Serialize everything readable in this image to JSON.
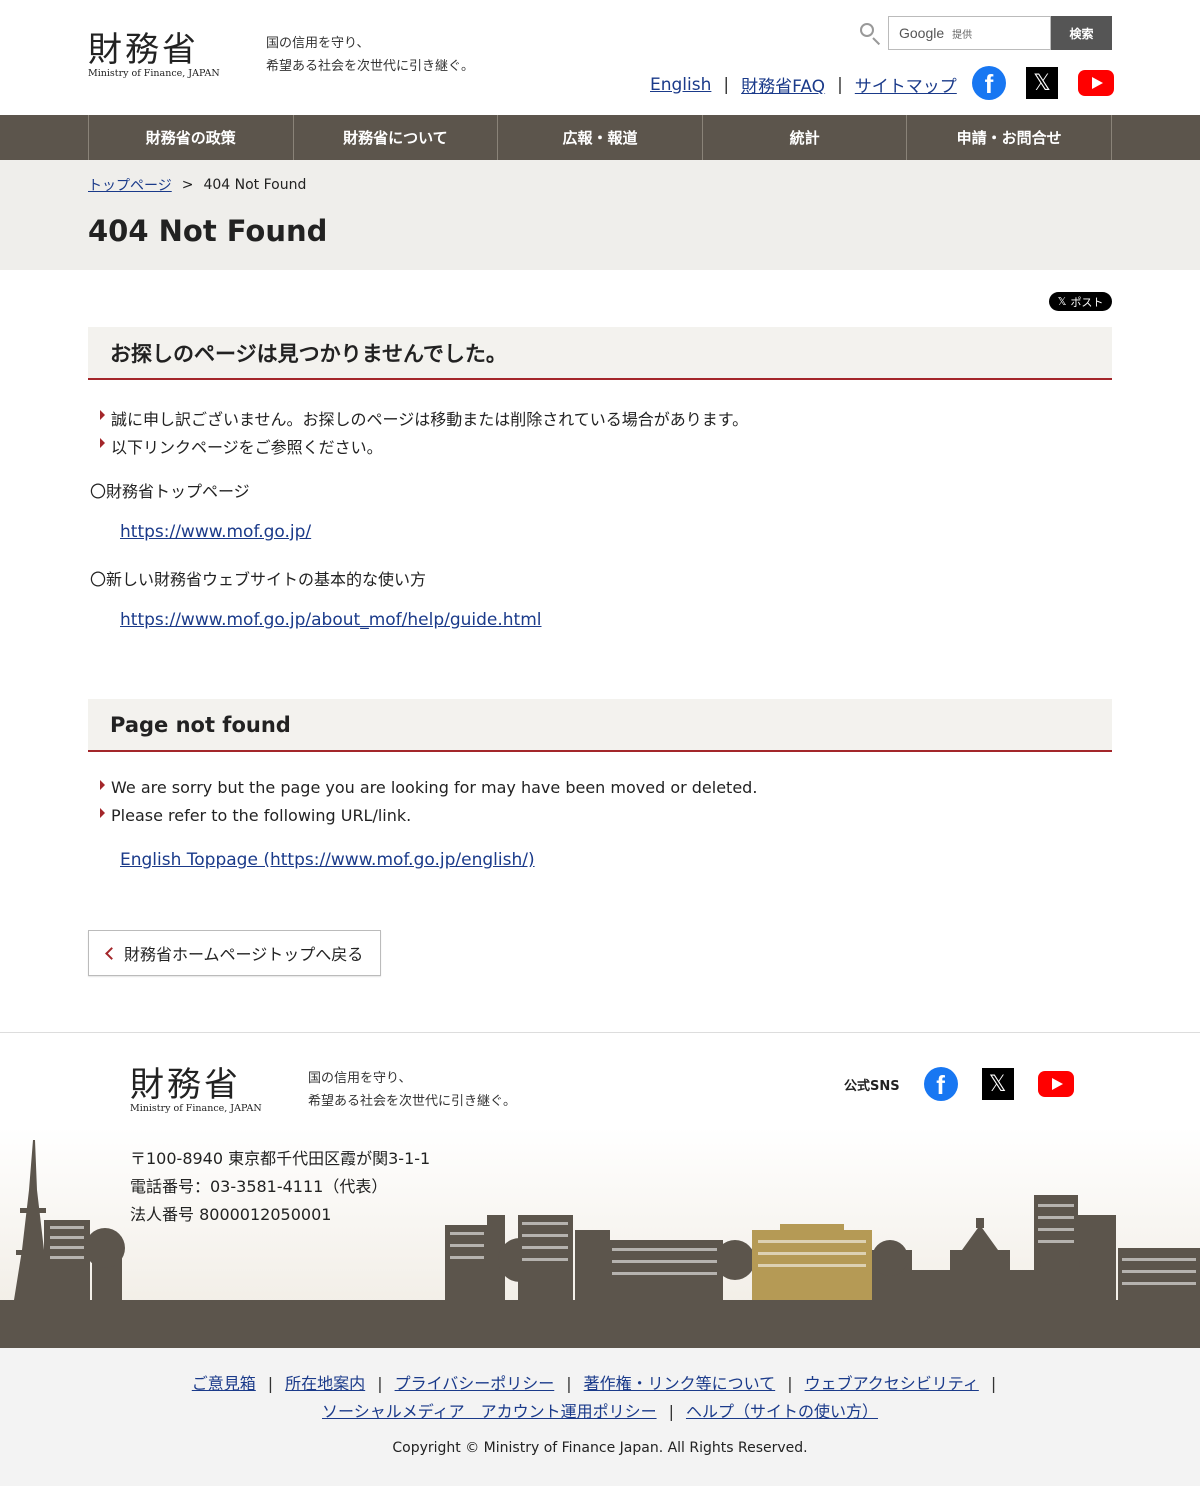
{
  "header": {
    "logo_kanji": "財務省",
    "logo_en": "Ministry of Finance, JAPAN",
    "tagline_1": "国の信用を守り、",
    "tagline_2": "希望ある社会を次世代に引き継ぐ。",
    "search_brand": "Google",
    "search_brand_suffix": "提供",
    "search_button": "検索",
    "links": [
      "English",
      "財務省FAQ",
      "サイトマップ"
    ],
    "separator": "|"
  },
  "nav": [
    "財務省の政策",
    "財務省について",
    "広報・報道",
    "統計",
    "申請・お問合せ"
  ],
  "breadcrumb": {
    "home": "トップページ",
    "sep": ">",
    "current": "404 Not Found"
  },
  "page_title": "404 Not Found",
  "post_button": "ポスト",
  "jp_section": {
    "heading": "お探しのページは見つかりませんでした。",
    "bullets": [
      "誠に申し訳ございません。お探しのページは移動または削除されている場合があります。",
      "以下リンクページをご参照ください。"
    ],
    "item1_label": "〇財務省トップページ",
    "item1_link": "https://www.mof.go.jp/",
    "item2_label": "〇新しい財務省ウェブサイトの基本的な使い方",
    "item2_link": "https://www.mof.go.jp/about_mof/help/guide.html"
  },
  "en_section": {
    "heading": "Page not found",
    "bullets": [
      "We are sorry but the page you are looking for may have been moved or deleted.",
      "Please refer to the following URL/link."
    ],
    "link": "English Toppage (https://www.mof.go.jp/english/)"
  },
  "back_button": "財務省ホームページトップへ戻る",
  "footer": {
    "logo_kanji": "財務省",
    "logo_en": "Ministry of Finance, JAPAN",
    "tagline_1": "国の信用を守り、",
    "tagline_2": "希望ある社会を次世代に引き継ぐ。",
    "sns_label": "公式SNS",
    "address": "〒100-8940 東京都千代田区霞が関3-1-1",
    "phone": "電話番号：03-3581-4111（代表）",
    "corp_number": "法人番号 8000012050001"
  },
  "bottom_links_row1": [
    "ご意見箱",
    "所在地案内",
    "プライバシーポリシー",
    "著作権・リンク等について",
    "ウェブアクセシビリティ"
  ],
  "bottom_links_row2": [
    "ソーシャルメディア　アカウント運用ポリシー",
    "ヘルプ（サイトの使い方）"
  ],
  "copyright": "Copyright © Ministry of Finance Japan. All Rights Reserved.",
  "colors": {
    "nav_bg": "#5c554c",
    "accent_red": "#a3262a",
    "link": "#1a3a8a",
    "title_band": "#efeeeb",
    "gold_building": "#b59a55"
  },
  "icons": [
    "search-icon",
    "facebook-icon",
    "x-icon",
    "youtube-icon",
    "chevron-left-icon"
  ]
}
